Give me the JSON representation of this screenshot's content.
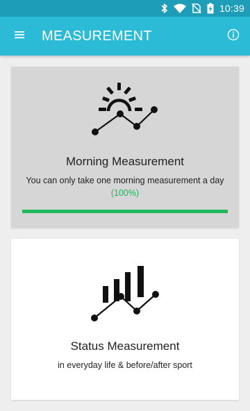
{
  "status_bar": {
    "time": "10:39",
    "icons": [
      "bluetooth-icon",
      "wifi-icon",
      "no-sim-icon",
      "battery-charging-icon"
    ]
  },
  "app_bar": {
    "title": "MEASUREMENT",
    "menu_icon": "menu-icon",
    "info_icon": "info-icon"
  },
  "cards": {
    "morning": {
      "icon": "sunrise-chart-icon",
      "title": "Morning Measurement",
      "subtitle": "You can only take one morning measurement a day",
      "percent_label": "(100%)",
      "progress": 1.0,
      "progress_color": "#1fb85a"
    },
    "status": {
      "icon": "bar-chart-trend-icon",
      "title": "Status Measurement",
      "subtitle": "in everyday life & before/after sport"
    }
  },
  "colors": {
    "app_bar": "#2bbbd6",
    "status_bar": "#1e9db9",
    "background": "#eeeeee",
    "morning_card": "#d6d6d6",
    "status_card": "#ffffff"
  }
}
